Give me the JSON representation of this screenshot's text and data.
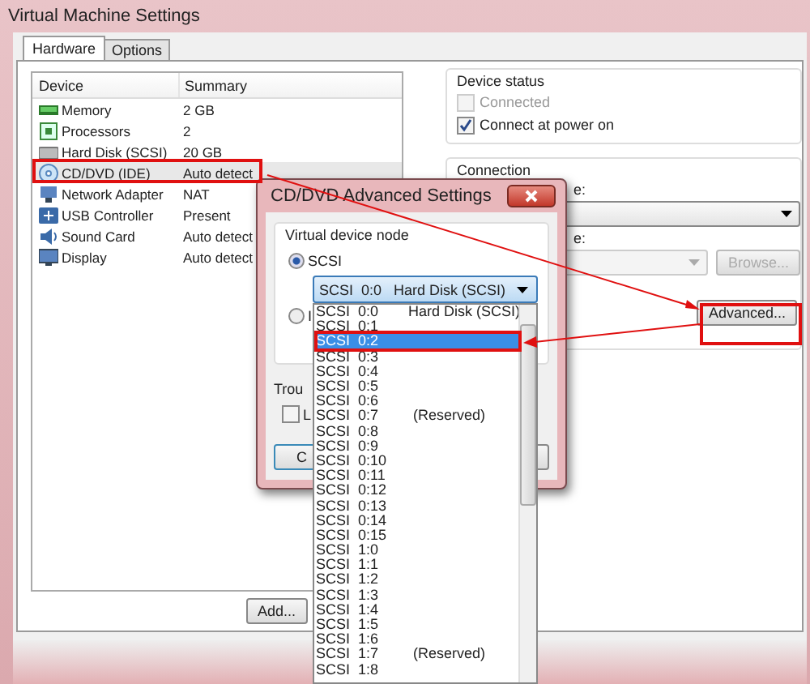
{
  "window": {
    "title": "Virtual Machine Settings"
  },
  "tabs": [
    {
      "label": "Hardware",
      "selected": true
    },
    {
      "label": "Options",
      "selected": false
    }
  ],
  "device_table": {
    "columns": [
      "Device",
      "Summary"
    ],
    "rows": [
      {
        "kind": "memory",
        "device": "Memory",
        "summary": "2 GB",
        "selected": false
      },
      {
        "kind": "processor",
        "device": "Processors",
        "summary": "2",
        "selected": false
      },
      {
        "kind": "disk",
        "device": "Hard Disk (SCSI)",
        "summary": "20 GB",
        "selected": false
      },
      {
        "kind": "cdrom",
        "device": "CD/DVD (IDE)",
        "summary": "Auto detect",
        "selected": true
      },
      {
        "kind": "network",
        "device": "Network Adapter",
        "summary": "NAT",
        "selected": false
      },
      {
        "kind": "usb",
        "device": "USB Controller",
        "summary": "Present",
        "selected": false
      },
      {
        "kind": "sound",
        "device": "Sound Card",
        "summary": "Auto detect",
        "selected": false
      },
      {
        "kind": "display",
        "device": "Display",
        "summary": "Auto detect",
        "selected": false
      }
    ]
  },
  "add_button": "Add...",
  "device_status": {
    "title": "Device status",
    "options": [
      {
        "label": "Connected",
        "checked": false,
        "disabled": true
      },
      {
        "label": "Connect at power on",
        "checked": true,
        "disabled": false
      }
    ]
  },
  "connection": {
    "title": "Connection",
    "label_1": "e:",
    "label_2": "e:",
    "browse_button": {
      "label": "Browse...",
      "disabled": true
    },
    "advanced_button": "Advanced..."
  },
  "dialog": {
    "title": "CD/DVD Advanced Settings",
    "group_title": "Virtual device node",
    "radios": [
      {
        "label": "SCSI",
        "selected": true
      },
      {
        "label": "I",
        "selected": false
      }
    ],
    "scsi_select": "SCSI  0:0   Hard Disk (SCSI)",
    "troubleshoot_label": "Trou",
    "checkbox": {
      "label": "L",
      "checked": false
    },
    "button": "C"
  },
  "dropdown_list": {
    "items": [
      {
        "label": "SCSI  0:0",
        "note": "Hard Disk (SCSI)",
        "selected": false
      },
      {
        "label": "SCSI  0:1",
        "selected": false
      },
      {
        "label": "SCSI  0:2",
        "selected": true
      },
      {
        "label": "SCSI  0:3",
        "selected": false
      },
      {
        "label": "SCSI  0:4",
        "selected": false
      },
      {
        "label": "SCSI  0:5",
        "selected": false
      },
      {
        "label": "SCSI  0:6",
        "selected": false
      },
      {
        "label": "SCSI  0:7",
        "note": "(Reserved)",
        "selected": false
      },
      {
        "label": "SCSI  0:8",
        "selected": false
      },
      {
        "label": "SCSI  0:9",
        "selected": false
      },
      {
        "label": "SCSI  0:10",
        "selected": false
      },
      {
        "label": "SCSI  0:11",
        "selected": false
      },
      {
        "label": "SCSI  0:12",
        "selected": false
      },
      {
        "label": "SCSI  0:13",
        "selected": false
      },
      {
        "label": "SCSI  0:14",
        "selected": false
      },
      {
        "label": "SCSI  0:15",
        "selected": false
      },
      {
        "label": "SCSI  1:0",
        "selected": false
      },
      {
        "label": "SCSI  1:1",
        "selected": false
      },
      {
        "label": "SCSI  1:2",
        "selected": false
      },
      {
        "label": "SCSI  1:3",
        "selected": false
      },
      {
        "label": "SCSI  1:4",
        "selected": false
      },
      {
        "label": "SCSI  1:5",
        "selected": false
      },
      {
        "label": "SCSI  1:6",
        "selected": false
      },
      {
        "label": "SCSI  1:7",
        "note": "(Reserved)",
        "selected": false
      },
      {
        "label": "SCSI  1:8",
        "selected": false
      }
    ]
  }
}
